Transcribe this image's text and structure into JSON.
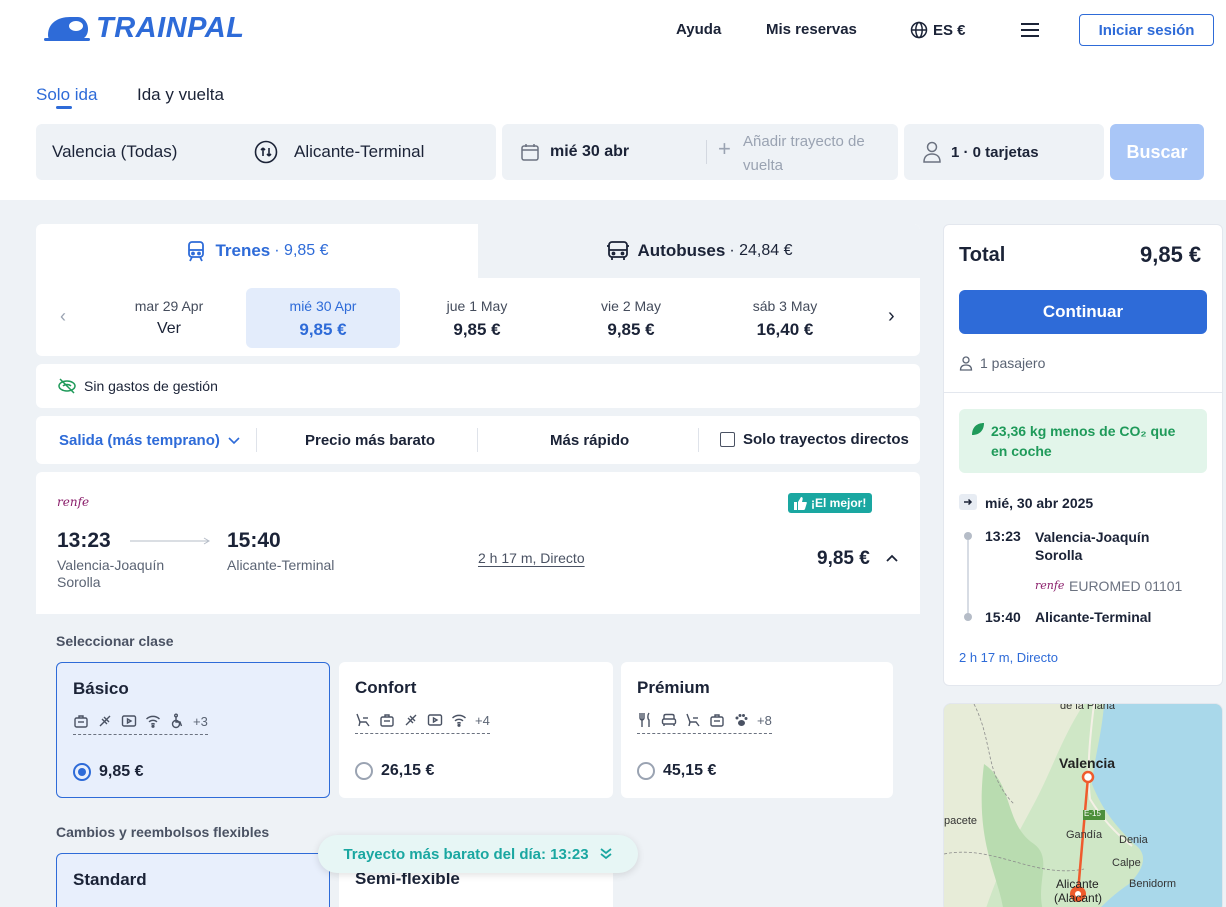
{
  "header": {
    "brand": "TRAINPAL",
    "nav": {
      "help": "Ayuda",
      "bookings": "Mis reservas",
      "lang": "ES €",
      "login": "Iniciar sesión"
    }
  },
  "trip_type": {
    "one_way": "Solo ida",
    "round_trip": "Ida y vuelta"
  },
  "search": {
    "origin": "Valencia (Todas)",
    "destination": "Alicante-Terminal",
    "date": "mié 30 abr",
    "return_placeholder_line1": "Añadir trayecto de",
    "return_placeholder_line2": "vuelta",
    "passengers": "1 · 0 tarjetas",
    "button": "Buscar"
  },
  "mode_tabs": [
    {
      "label": "Trenes",
      "price": "· 9,85 €"
    },
    {
      "label": "Autobuses",
      "price": "· 24,84 €"
    }
  ],
  "dates": [
    {
      "day": "mar 29 Apr",
      "price": "Ver"
    },
    {
      "day": "mié 30 Apr",
      "price": "9,85 €"
    },
    {
      "day": "jue 1 May",
      "price": "9,85 €"
    },
    {
      "day": "vie 2 May",
      "price": "9,85 €"
    },
    {
      "day": "sáb 3 May",
      "price": "16,40 €"
    }
  ],
  "no_fees": "Sin gastos de gestión",
  "sort": {
    "departure": "Salida (más temprano)",
    "cheapest": "Precio más barato",
    "fastest": "Más rápido",
    "direct_only": "Solo trayectos directos"
  },
  "journey": {
    "operator": "renfe",
    "badge": "¡El mejor!",
    "dep_time": "13:23",
    "dep_station_1": "Valencia-Joaquín",
    "dep_station_2": "Sorolla",
    "arr_time": "15:40",
    "arr_station": "Alicante-Terminal",
    "duration": "2 h 17 m, Directo",
    "price": "9,85 €"
  },
  "select_class_label": "Seleccionar clase",
  "classes": [
    {
      "name": "Básico",
      "more": "+3",
      "price": "9,85 €"
    },
    {
      "name": "Confort",
      "more": "+4",
      "price": "26,15 €"
    },
    {
      "name": "Prémium",
      "more": "+8",
      "price": "45,15 €"
    }
  ],
  "flex_label": "Cambios y reembolsos flexibles",
  "flex_options": [
    {
      "name": "Standard"
    },
    {
      "name": "Semi-flexible"
    }
  ],
  "cheapest_toast": "Trayecto más barato del día: 13:23",
  "summary": {
    "total_label": "Total",
    "total_price": "9,85 €",
    "continue": "Continuar",
    "passengers": "1 pasajero",
    "co2_line1": "23,36 kg menos de CO₂ que",
    "co2_line2": "en coche",
    "date": "mié, 30 abr 2025",
    "dep_time": "13:23",
    "dep_station_1": "Valencia-Joaquín",
    "dep_station_2": "Sorolla",
    "train": "EUROMED 01101",
    "arr_time": "15:40",
    "arr_station": "Alicante-Terminal",
    "duration": "2 h 17 m, Directo"
  },
  "map": {
    "labels": [
      "de la Plana",
      "Valencia",
      "E-15",
      "pacete",
      "Gandía",
      "Denia",
      "Calpe",
      "Benidorm",
      "Alicante",
      "(Alacant)"
    ]
  },
  "colors": {
    "accent": "#2e6bd8",
    "green": "#1f9a5a",
    "teal": "#1aa7a1",
    "renfe": "#8a1d6a"
  }
}
